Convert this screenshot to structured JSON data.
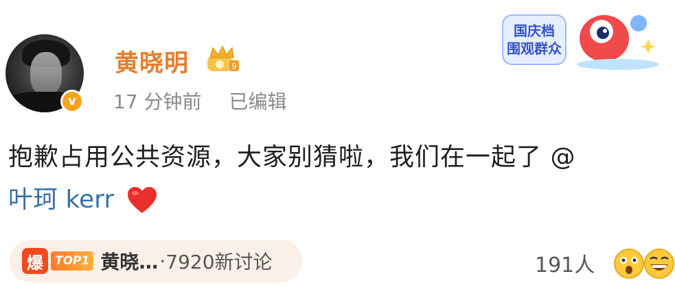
{
  "post": {
    "author": "黄晓明",
    "time": "17 分钟前",
    "edited": "已编辑",
    "verified_mark": "v",
    "text_line1": "抱歉占用公共资源，大家别猜啦，我们在一起了 @",
    "mention": "叶珂 kerr",
    "heart_icon": "red-heart-icon"
  },
  "event_sticker": {
    "line1": "国庆档",
    "line2": "围观群众"
  },
  "trend": {
    "bao_label": "爆",
    "top_label": "TOP1",
    "topic": "黄晓…",
    "separator": "·",
    "discussions": "7920新讨论"
  },
  "reactions": {
    "count": "191人",
    "emoji_icons": [
      "surprised-face-icon",
      "grinning-face-icon"
    ]
  },
  "colors": {
    "username": "#e97d2c",
    "mention": "#3a6fa6",
    "verified": "#f7a21b",
    "trend_bg": "#faf0e8",
    "bao": "#f04a1f"
  }
}
